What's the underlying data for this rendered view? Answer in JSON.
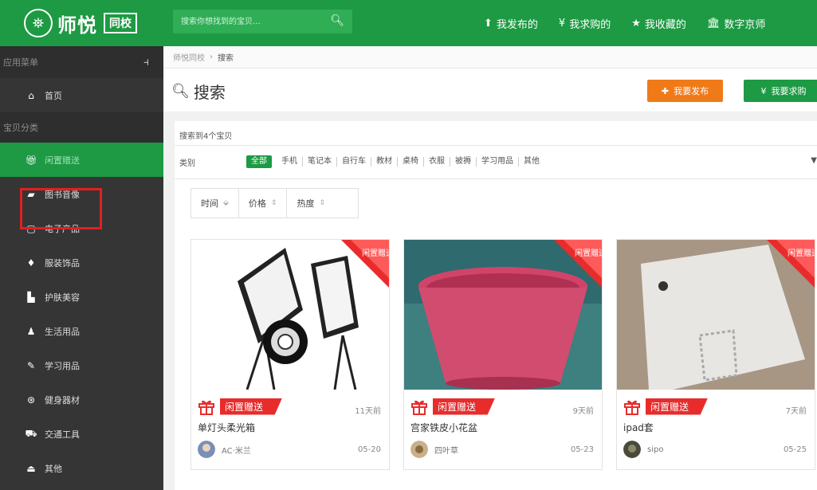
{
  "header": {
    "logo_text": "师悦",
    "logo_badge": "同校",
    "search_placeholder": "搜索你想找到的宝贝...",
    "nav": [
      {
        "icon": "upload-icon",
        "label": "我发布的"
      },
      {
        "icon": "yen-icon",
        "label": "我求购的"
      },
      {
        "icon": "star-icon",
        "label": "我收藏的"
      },
      {
        "icon": "bank-icon",
        "label": "数字京师"
      }
    ],
    "brand_color": "#1d9a43"
  },
  "sidebar": {
    "menu_title": "应用菜单",
    "home_label": "首页",
    "section_title": "宝贝分类",
    "items": [
      {
        "icon": "gift-icon",
        "label": "闲置赠送"
      },
      {
        "icon": "book-icon",
        "label": "图书音像"
      },
      {
        "icon": "monitor-icon",
        "label": "电子产品"
      },
      {
        "icon": "diamond-icon",
        "label": "服装饰品"
      },
      {
        "icon": "cosmetic-icon",
        "label": "护肤美容"
      },
      {
        "icon": "person-icon",
        "label": "生活用品"
      },
      {
        "icon": "edit-icon",
        "label": "学习用品"
      },
      {
        "icon": "fitness-icon",
        "label": "健身器材"
      },
      {
        "icon": "car-icon",
        "label": "交通工具"
      },
      {
        "icon": "bag-icon",
        "label": "其他"
      }
    ]
  },
  "breadcrumb": {
    "root": "师悦同校",
    "current": "搜索"
  },
  "page": {
    "title": "搜索",
    "publish_button": "我要发布",
    "want_button": "我要求购",
    "publish_color": "#f07a18"
  },
  "filters": {
    "result_count": "搜索到4个宝贝",
    "category_label": "类别",
    "categories": [
      "全部",
      "手机",
      "笔记本",
      "自行车",
      "教材",
      "桌椅",
      "衣服",
      "被褥",
      "学习用品",
      "其他"
    ],
    "sorts": [
      {
        "label": "时间",
        "arrow": "⬙"
      },
      {
        "label": "价格",
        "arrow": "⇕"
      },
      {
        "label": "热度",
        "arrow": "⇕"
      }
    ]
  },
  "items": [
    {
      "tag": "闲置赠送",
      "ago": "11天前",
      "title": "单灯头柔光箱",
      "user": "AC·米兰",
      "date": "05-20",
      "ribbon": "闲置赠送"
    },
    {
      "tag": "闲置赠送",
      "ago": "9天前",
      "title": "宫家铁皮小花盆",
      "user": "四叶草",
      "date": "05-23",
      "ribbon": "闲置赠送"
    },
    {
      "tag": "闲置赠送",
      "ago": "7天前",
      "title": "ipad套",
      "user": "sipo",
      "date": "05-25",
      "ribbon": "闲置赠送"
    }
  ]
}
